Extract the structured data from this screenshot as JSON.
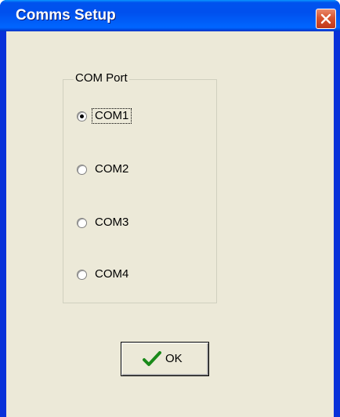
{
  "window": {
    "title": "Comms Setup",
    "close_icon": "close-icon"
  },
  "com_port_group": {
    "label": "COM Port",
    "selected": "COM1",
    "options": [
      {
        "label": "COM1",
        "checked": true
      },
      {
        "label": "COM2",
        "checked": false
      },
      {
        "label": "COM3",
        "checked": false
      },
      {
        "label": "COM4",
        "checked": false
      }
    ]
  },
  "ok_button": {
    "label": "OK",
    "icon": "checkmark-icon",
    "icon_color": "#1a8a1a"
  },
  "colors": {
    "title_bar": "#0053ee",
    "close_button": "#d8532f",
    "dialog_face": "#ece9d8"
  }
}
